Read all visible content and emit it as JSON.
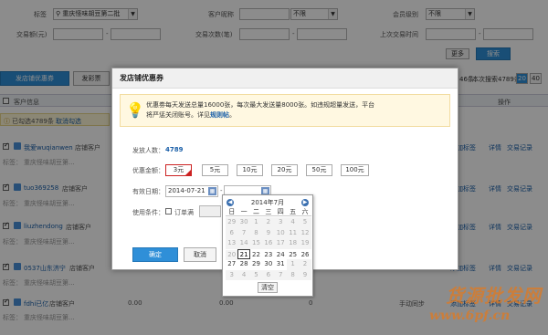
{
  "filters": {
    "tag_label": "标签",
    "tag_value": "重庆怪味胡豆第二批",
    "nickname_label": "客户昵称",
    "nickname_select": "不限",
    "level_label": "会员级别",
    "level_select": "不限",
    "amount_label": "交易额(元)",
    "count_label": "交易次数(笔)",
    "last_trade_label": "上次交易时间",
    "range_sep": "-",
    "more_button": "更多",
    "search_button": "搜索"
  },
  "toolbar": {
    "send_coupon_tab": "发店铺优惠券",
    "send_mail_tab": "发彩票",
    "summary_left": "46条",
    "summary_right": "本次搜索4789条",
    "page_size_20": "20",
    "page_size_40": "40"
  },
  "table": {
    "col_customer": "客户信息",
    "col_action": "操作",
    "selected_text": "已勾选4789条",
    "cancel_select": "取消勾选",
    "action_add_tag": "添加标签",
    "action_detail": "详情",
    "action_records": "交易记录",
    "rows": [
      {
        "name": "我爱wuqianwen",
        "type": "店铺客户",
        "tag": "重庆怪味胡豆第..."
      },
      {
        "name": "tuo369258",
        "type": "店铺客户",
        "tag": "重庆怪味胡豆第..."
      },
      {
        "name": "liuzhendong",
        "type": "店铺客户",
        "tag": "重庆怪味胡豆第..."
      },
      {
        "name": "0537山东济宁",
        "type": "店铺客户",
        "tag": "重庆怪味胡豆第..."
      },
      {
        "name": "fdhi已亿",
        "type": "店铺客户",
        "tag": "重庆怪味胡豆第..."
      }
    ],
    "last_row_val1": "0.00",
    "last_row_val2": "0.00",
    "last_row_val3": "0",
    "last_row_status": "手动同步"
  },
  "dialog": {
    "title": "发店铺优惠券",
    "notice_line1": "优惠劵每天发送总量16000张，每次最大发送量8000张。如违规超量发送，平台",
    "notice_line2_prefix": "将严惩关闭账号。详见",
    "notice_link": "规则帖",
    "notice_suffix": "。",
    "recipients_label": "发放人数：",
    "recipients_value": "4789",
    "amount_label": "优惠金额：",
    "amounts": [
      "3元",
      "5元",
      "10元",
      "20元",
      "50元",
      "100元"
    ],
    "valid_label": "有效日期：",
    "valid_start": "2014-07-21",
    "valid_sep": "-",
    "condition_label": "使用条件：",
    "condition_option": "订单满",
    "confirm_button": "确定",
    "cancel_button": "取消"
  },
  "calendar": {
    "month_title": "2014年7月",
    "weekdays": [
      "日",
      "一",
      "二",
      "三",
      "四",
      "五",
      "六"
    ],
    "weeks": [
      [
        "29",
        "30",
        "1",
        "2",
        "3",
        "4",
        "5"
      ],
      [
        "6",
        "7",
        "8",
        "9",
        "10",
        "11",
        "12"
      ],
      [
        "13",
        "14",
        "15",
        "16",
        "17",
        "18",
        "19"
      ],
      [
        "20",
        "21",
        "22",
        "23",
        "24",
        "25",
        "26"
      ],
      [
        "27",
        "28",
        "29",
        "30",
        "31",
        "1",
        "2"
      ],
      [
        "3",
        "4",
        "5",
        "6",
        "7",
        "8",
        "9"
      ]
    ],
    "selected_day": "21",
    "clear_button": "清空"
  },
  "watermark": {
    "cn": "货源批发网",
    "url": "www.6pf.cn"
  },
  "colors": {
    "primary_blue": "#2f8fd8",
    "link_blue": "#1a5fa8",
    "notice_bg": "#fff8e1",
    "selected_red": "#cc2222"
  }
}
